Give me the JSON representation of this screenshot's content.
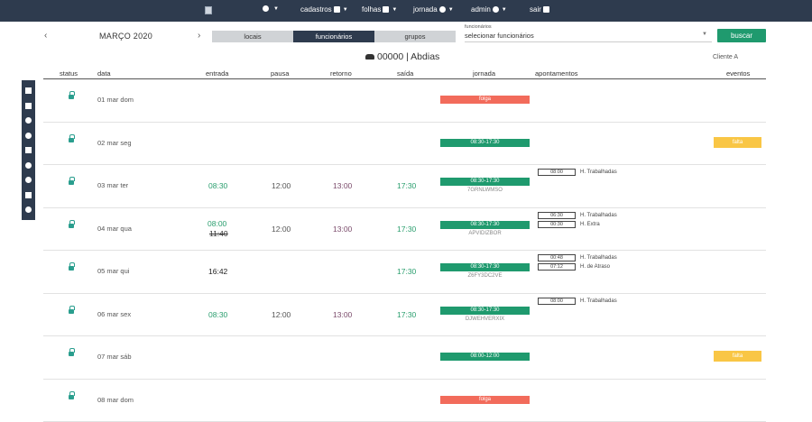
{
  "nav": {
    "items": [
      {
        "label": "",
        "icon": "bell-icon"
      },
      {
        "label": "cadastros",
        "icon": "people-icon"
      },
      {
        "label": "folhas",
        "icon": "document-icon"
      },
      {
        "label": "jornada",
        "icon": "clock-icon"
      },
      {
        "label": "admin",
        "icon": "gear-icon"
      },
      {
        "label": "sair",
        "icon": "user-add-icon"
      }
    ]
  },
  "month": {
    "label": "MARÇO 2020",
    "prev": "‹",
    "next": "›"
  },
  "tabs": [
    "locais",
    "funcionários",
    "grupos"
  ],
  "active_tab": "funcionários",
  "select": {
    "label": "funcionários",
    "value": "selecionar funcionários"
  },
  "search_button": "buscar",
  "employee": {
    "title": "00000 | Abdias"
  },
  "client": "Cliente A",
  "columns": [
    "status",
    "data",
    "entrada",
    "pausa",
    "retorno",
    "saída",
    "jornada",
    "apontamentos",
    "eventos"
  ],
  "rows": [
    {
      "date": "01 mar dom",
      "entrada": "",
      "entrada_old": "",
      "pausa": "",
      "retorno": "",
      "saida": "",
      "jornada": "folga",
      "jornada_type": "red",
      "code": "",
      "apontamentos": [],
      "evento": ""
    },
    {
      "date": "02 mar seg",
      "entrada": "",
      "entrada_old": "",
      "pausa": "",
      "retorno": "",
      "saida": "",
      "jornada": "08:30-17:30",
      "jornada_type": "green",
      "code": "",
      "apontamentos": [],
      "evento": "falta"
    },
    {
      "date": "03 mar ter",
      "entrada": "08:30",
      "entrada_old": "",
      "pausa": "12:00",
      "retorno": "13:00",
      "saida": "17:30",
      "jornada": "08:30-17:30",
      "jornada_type": "green",
      "code": "7GRNLWMSO",
      "apontamentos": [
        {
          "value": "08:00",
          "label": "H. Trabalhadas"
        }
      ],
      "evento": ""
    },
    {
      "date": "04 mar qua",
      "entrada": "08:00",
      "entrada_old": "11:40",
      "pausa": "12:00",
      "retorno": "13:00",
      "saida": "17:30",
      "jornada": "08:30-17:30",
      "jornada_type": "green",
      "code": "APVIDIZBOR",
      "apontamentos": [
        {
          "value": "06:30",
          "label": "H. Trabalhadas"
        },
        {
          "value": "00:30",
          "label": "H. Extra"
        }
      ],
      "evento": ""
    },
    {
      "date": "05 mar qui",
      "entrada": "16:42",
      "entrada_old": "",
      "pausa": "",
      "retorno": "",
      "saida": "17:30",
      "jornada": "08:30-17:30",
      "jornada_type": "green",
      "code": "Z6FY3DC2VE",
      "apontamentos": [
        {
          "value": "00:48",
          "label": "H. Trabalhadas"
        },
        {
          "value": "07:12",
          "label": "H. de Atraso"
        }
      ],
      "evento": ""
    },
    {
      "date": "06 mar sex",
      "entrada": "08:30",
      "entrada_old": "",
      "pausa": "12:00",
      "retorno": "13:00",
      "saida": "17:30",
      "jornada": "08:30-17:30",
      "jornada_type": "green",
      "code": "DJWEHVERXIX",
      "apontamentos": [
        {
          "value": "08:00",
          "label": "H. Trabalhadas"
        }
      ],
      "evento": ""
    },
    {
      "date": "07 mar sáb",
      "entrada": "",
      "entrada_old": "",
      "pausa": "",
      "retorno": "",
      "saida": "",
      "jornada": "08:00-12:00",
      "jornada_type": "green",
      "code": "",
      "apontamentos": [],
      "evento": "falta"
    },
    {
      "date": "08 mar dom",
      "entrada": "",
      "entrada_old": "",
      "pausa": "",
      "retorno": "",
      "saida": "",
      "jornada": "folga",
      "jornada_type": "red",
      "code": "",
      "apontamentos": [],
      "evento": ""
    }
  ],
  "sidebar": {
    "icons": [
      "document-icon",
      "check-icon",
      "circle-icon",
      "plus-circle-icon",
      "chat-icon",
      "refresh-icon",
      "gear-icon",
      "lock-icon",
      "info-icon"
    ]
  },
  "colors": {
    "navbar": "#2e3b4e",
    "green": "#1f9a6e",
    "red": "#f26b5b",
    "yellow": "#f9c645"
  }
}
